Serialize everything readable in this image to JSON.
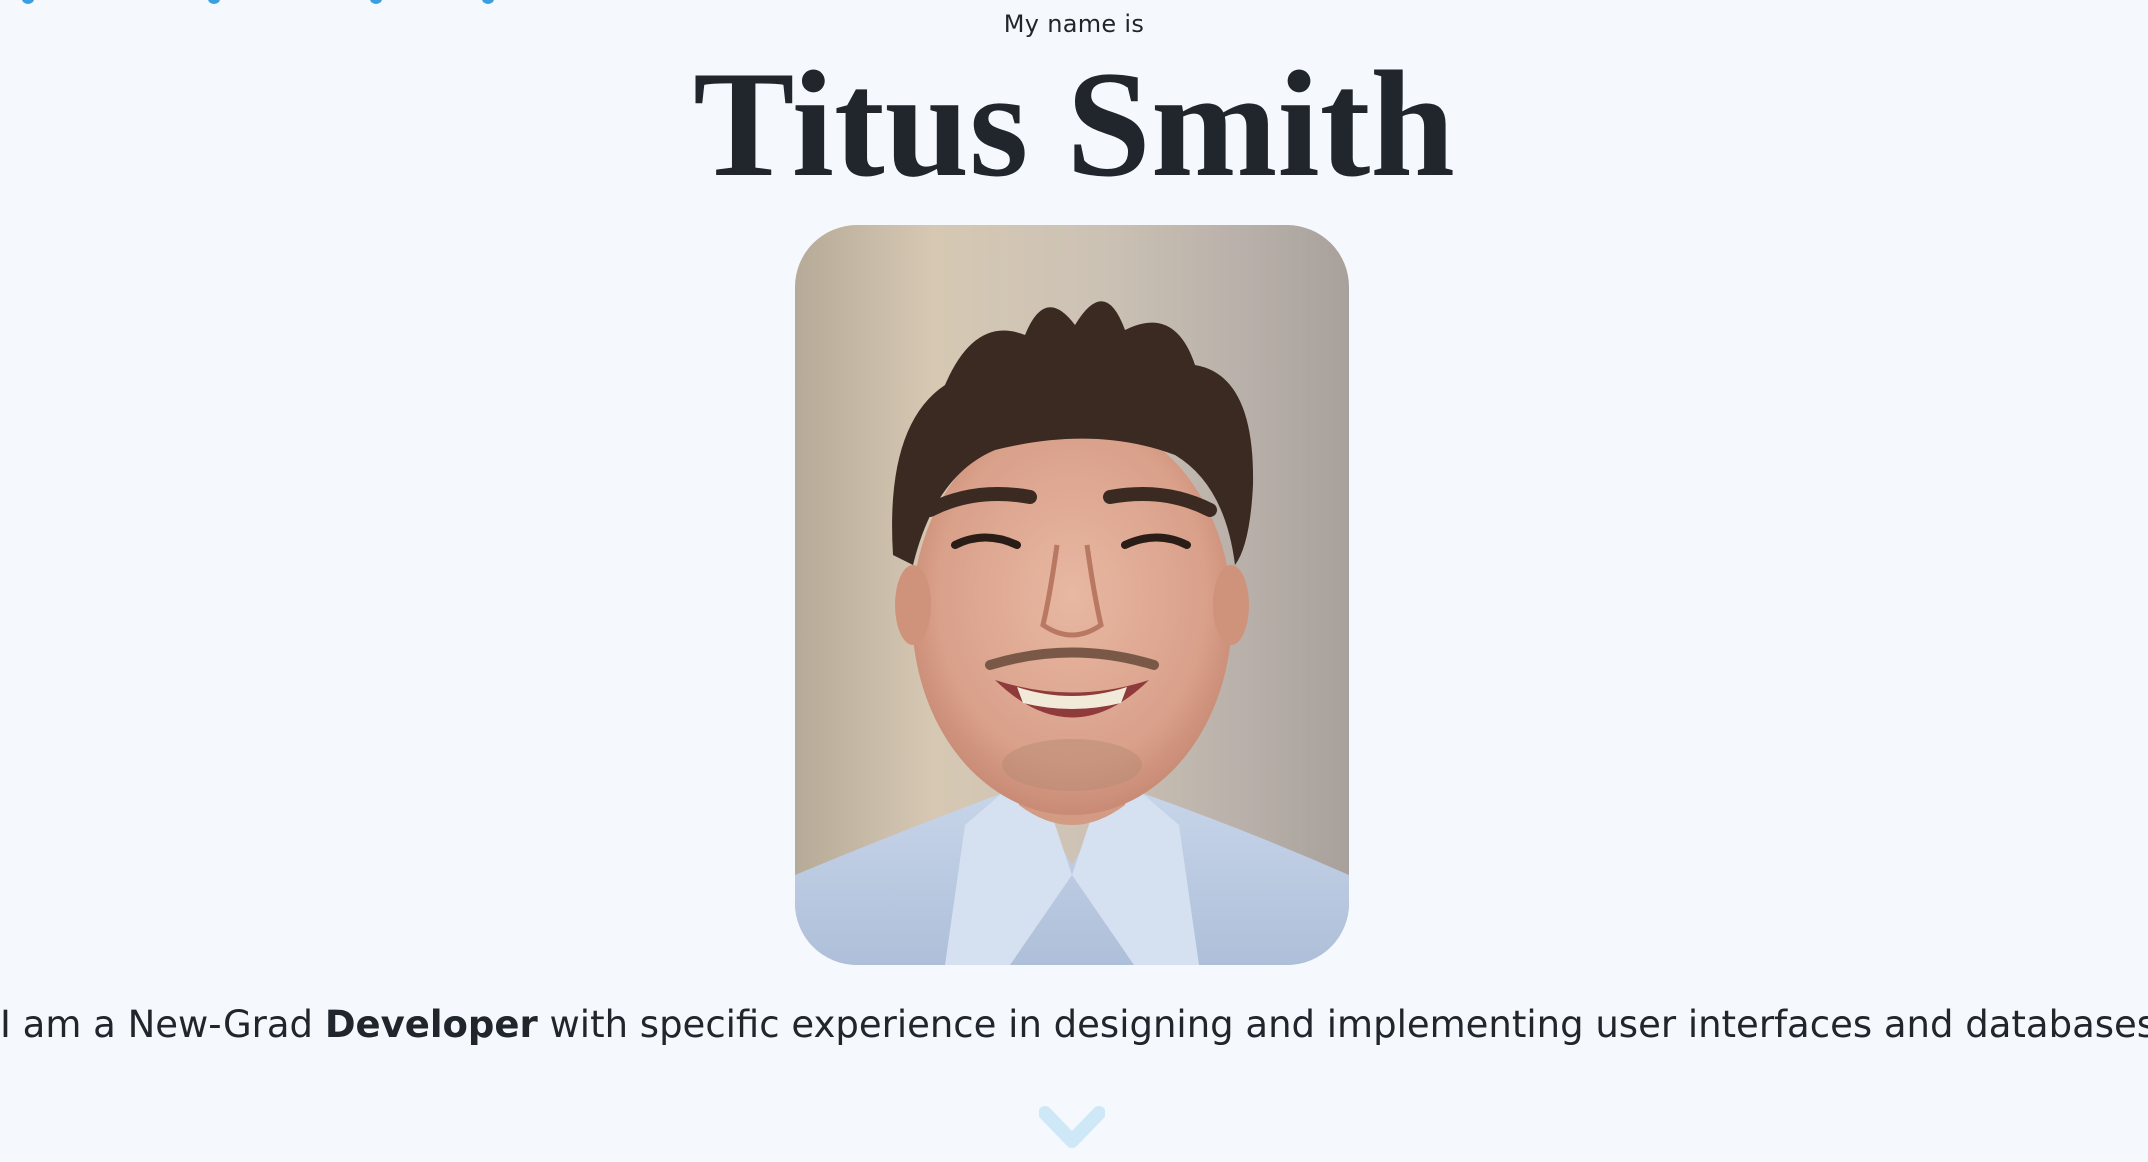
{
  "hero": {
    "intro": "My name is",
    "name": "Titus Smith",
    "photo_alt": "Portrait photo",
    "tagline_prefix": "I am a New-Grad ",
    "tagline_role": "Developer",
    "tagline_suffix": " with specific experience in designing and implementing user interfaces and databases."
  },
  "scroll": {
    "icon": "chevron-down-icon"
  },
  "colors": {
    "background": "#f5f9fd",
    "text": "#21262d",
    "accent": "#3a9ee0",
    "chevron": "#cfe8f7"
  }
}
